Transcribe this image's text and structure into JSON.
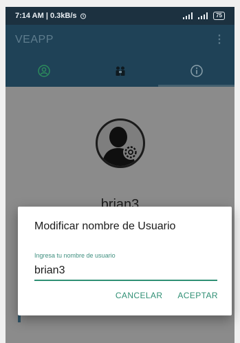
{
  "status_bar": {
    "time_speed": "7:14 AM | 0.3kB/s",
    "alarm_icon": "alarm-clock-icon",
    "battery": "75"
  },
  "app_bar": {
    "title": "VEAPP",
    "overflow_icon": "overflow-menu-icon"
  },
  "tabs": [
    {
      "icon": "person-icon",
      "active": false
    },
    {
      "icon": "group-icon",
      "active": false
    },
    {
      "icon": "info-icon",
      "active": true
    }
  ],
  "profile": {
    "username": "brian3",
    "avatar_icon": "user-settings-icon"
  },
  "dialog": {
    "title": "Modificar nombre de Usuario",
    "field_label": "Ingresa tu nombre de usuario",
    "field_value": "brian3",
    "cancel_label": "CANCELAR",
    "accept_label": "ACEPTAR"
  },
  "colors": {
    "app_bar": "#1f4257",
    "status_bar": "#1c3140",
    "accent": "#2f8f74"
  }
}
